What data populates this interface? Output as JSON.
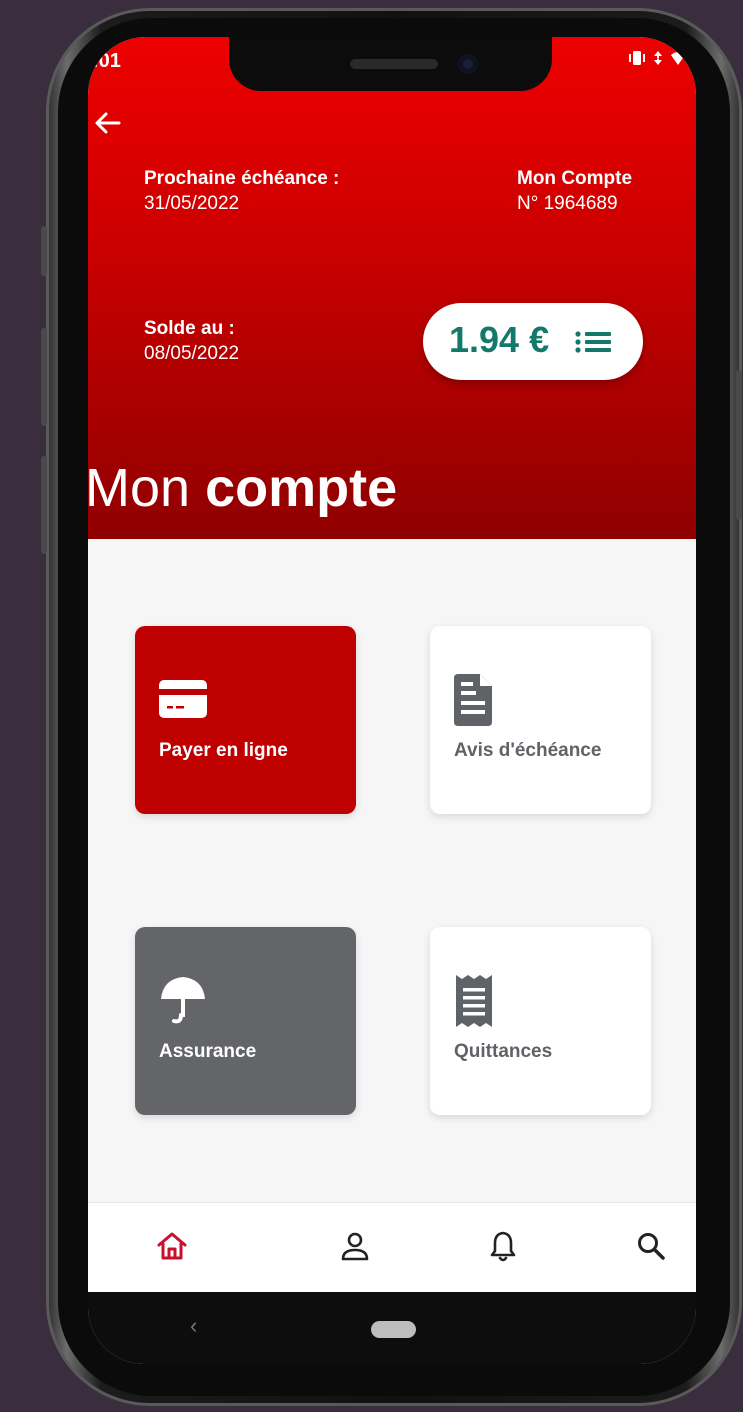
{
  "status_bar": {
    "time": ":01",
    "icons": [
      "vibrate-icon",
      "data-arrows-icon",
      "signal-icon"
    ]
  },
  "header": {
    "back_icon": "arrow-left-icon",
    "next_due_label": "Prochaine échéance :",
    "next_due_date": "31/05/2022",
    "account_label": "Mon Compte",
    "account_number": "N° 1964689",
    "balance_label": "Solde au :",
    "balance_date": "08/05/2022",
    "balance_amount": "1.94 €",
    "balance_list_icon": "list-icon",
    "title_light": "Mon",
    "title_bold": "compte",
    "gradient": [
      "#ee0000",
      "#8f0000"
    ]
  },
  "tiles": [
    {
      "label": "Payer en ligne",
      "icon": "credit-card-icon",
      "bg": "#bf0000",
      "fg": "#ffffff"
    },
    {
      "label": "Avis d'échéance",
      "icon": "document-icon",
      "bg": "#ffffff",
      "fg": "#5f6368"
    },
    {
      "label": "Assurance",
      "icon": "umbrella-icon",
      "bg": "#636569",
      "fg": "#ffffff"
    },
    {
      "label": "Quittances",
      "icon": "receipt-icon",
      "bg": "#ffffff",
      "fg": "#5f6368"
    }
  ],
  "bottom_nav": {
    "items": [
      {
        "name": "home",
        "icon": "home-icon",
        "active": true
      },
      {
        "name": "profile",
        "icon": "person-icon",
        "active": false
      },
      {
        "name": "notifications",
        "icon": "bell-icon",
        "active": false
      },
      {
        "name": "search",
        "icon": "search-icon",
        "active": false
      }
    ],
    "active_color": "#c8102e"
  },
  "system_nav": {
    "back_glyph": "‹"
  }
}
